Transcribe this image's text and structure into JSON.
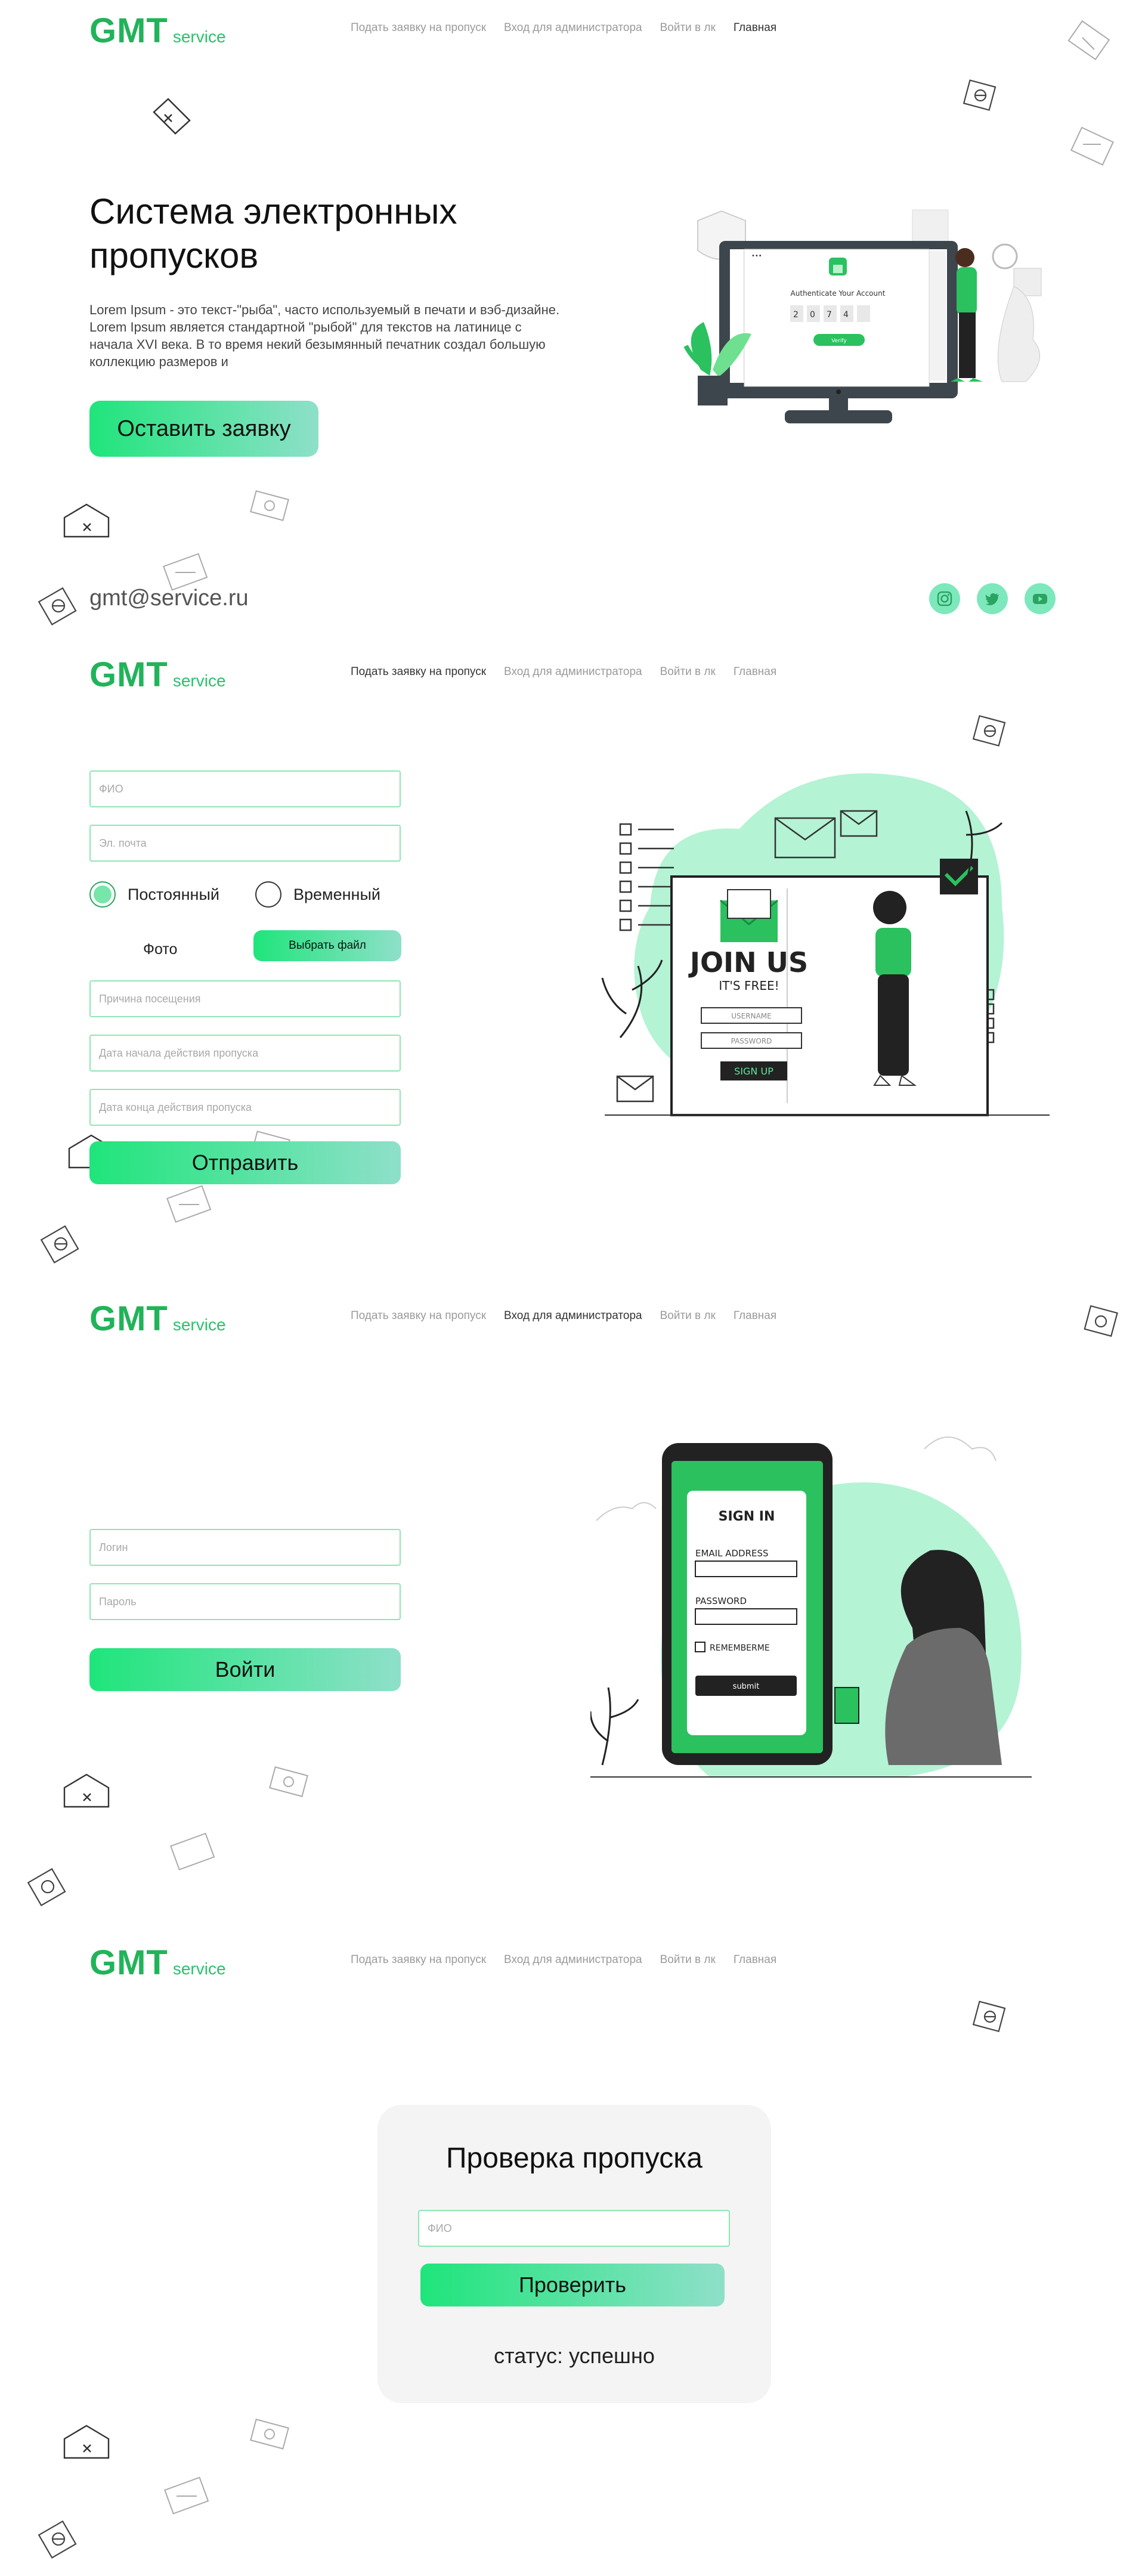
{
  "brand": {
    "logo_main": "GMT",
    "logo_sub": "service"
  },
  "nav": {
    "items": [
      "Подать заявку на пропуск",
      "Вход для администратора",
      "Войти в лк",
      "Главная"
    ]
  },
  "hero": {
    "title": "Система электронных пропусков",
    "text": "Lorem Ipsum - это текст-\"рыба\", часто используемый в печати и вэб-дизайне. Lorem Ipsum является стандартной \"рыбой\" для текстов на латинице с начала XVI века. В то время некий безымянный печатник создал большую коллекцию размеров и",
    "button": "Оставить заявку",
    "illustration_text": "Authenticate Your Account",
    "code": [
      "2",
      "0",
      "7",
      "4"
    ],
    "verify": "Verify"
  },
  "footer": {
    "email": "gmt@service.ru",
    "social": [
      "instagram-icon",
      "twitter-icon",
      "youtube-icon"
    ]
  },
  "application_form": {
    "fio_placeholder": "ФИО",
    "email_placeholder": "Эл. почта",
    "radio_permanent": "Постоянный",
    "radio_temporary": "Временный",
    "selected_type": "Постоянный",
    "photo_label": "Фото",
    "file_button": "Выбрать файл",
    "reason_placeholder": "Причина посещения",
    "start_placeholder": "Дата начала действия пропуска",
    "end_placeholder": "Дата конца действия пропуска",
    "submit": "Отправить",
    "illustration": {
      "join": "JOIN US",
      "free": "IT'S FREE!",
      "username": "USERNAME",
      "password": "PASSWORD",
      "signup": "SIGN UP"
    }
  },
  "admin_login": {
    "login_placeholder": "Логин",
    "password_placeholder": "Пароль",
    "submit": "Войти",
    "illustration": {
      "title": "SIGN IN",
      "email": "EMAIL ADDRESS",
      "password": "PASSWORD",
      "remember": "REMEMBERME",
      "submit": "submit"
    }
  },
  "pass_check": {
    "title": "Проверка пропуска",
    "fio_placeholder": "ФИО",
    "button": "Проверить",
    "status": "статус: успешно"
  },
  "colors": {
    "brand_green": "#22b35a",
    "accent_mint": "#b4f3d4",
    "gradient_start": "#1fe57b",
    "gradient_end": "#8ee0c9"
  }
}
